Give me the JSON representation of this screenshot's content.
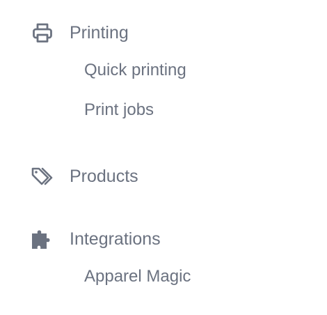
{
  "sidebar": {
    "sections": [
      {
        "label": "Printing",
        "icon": "printer-icon",
        "items": [
          {
            "label": "Quick printing"
          },
          {
            "label": "Print jobs"
          }
        ]
      },
      {
        "label": "Products",
        "icon": "tags-icon",
        "items": []
      },
      {
        "label": "Integrations",
        "icon": "puzzle-icon",
        "items": [
          {
            "label": "Apparel Magic"
          }
        ]
      }
    ]
  },
  "colors": {
    "text": "#6b7280",
    "icon": "#6b7280",
    "background": "#ffffff"
  }
}
